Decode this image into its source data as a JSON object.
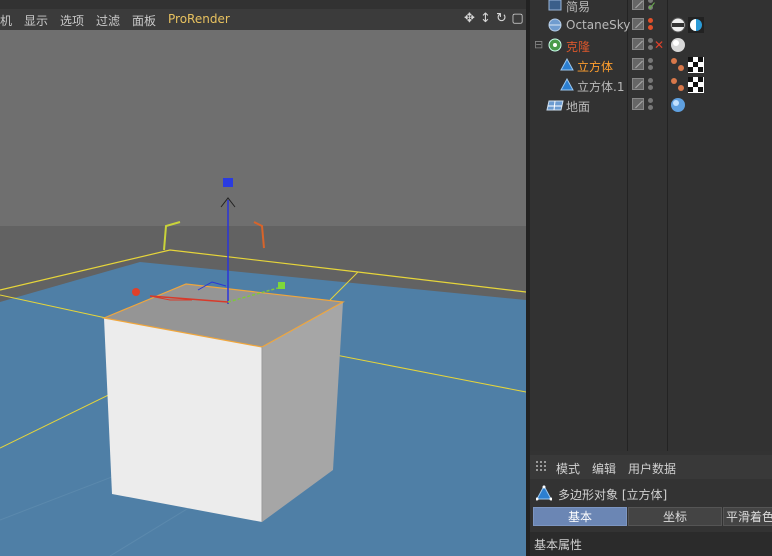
{
  "viewport": {
    "menu": [
      {
        "id": "camera",
        "label": "机"
      },
      {
        "id": "display",
        "label": "显示"
      },
      {
        "id": "options",
        "label": "选项"
      },
      {
        "id": "filter",
        "label": "过滤"
      },
      {
        "id": "panel",
        "label": "面板"
      },
      {
        "id": "prorender",
        "label": "ProRender"
      }
    ],
    "nav_icons": [
      "move-view-icon",
      "zoom-view-icon",
      "rotate-view-icon",
      "maximize-view-icon"
    ]
  },
  "object_manager": {
    "objects": [
      {
        "name": "简易",
        "color": "normal",
        "icon": "deformer-icon"
      },
      {
        "name": "OctaneSky",
        "color": "normal",
        "icon": "sky-icon"
      },
      {
        "name": "克隆",
        "color": "red",
        "icon": "cloner-icon"
      },
      {
        "name": "立方体",
        "color": "orange",
        "icon": "cube-icon"
      },
      {
        "name": "立方体.1",
        "color": "normal",
        "icon": "cube-icon"
      },
      {
        "name": "地面",
        "color": "normal",
        "icon": "floor-icon"
      }
    ]
  },
  "attributes": {
    "tabs": [
      "模式",
      "编辑",
      "用户数据"
    ],
    "object_title": "多边形对象 [立方体]",
    "subtabs": [
      "基本",
      "坐标",
      "平滑着色(Phong)"
    ],
    "active_subtab": "基本",
    "section": "基本属性"
  },
  "colors": {
    "accent": "#e7c15f",
    "selected_orange": "#ff9f2e",
    "cloner_red": "#d9562c",
    "floor_blue": "#4f7fa6",
    "active_tab": "#6b86b4"
  }
}
